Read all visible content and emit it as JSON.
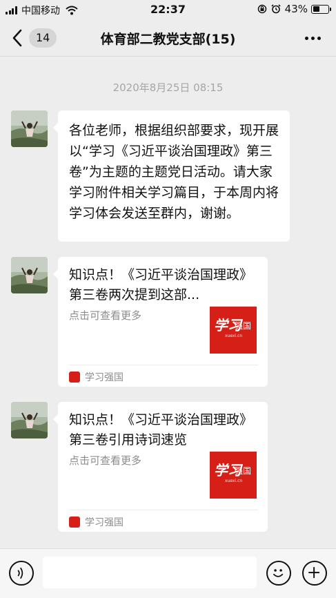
{
  "status_bar": {
    "carrier": "中国移动",
    "time": "22:37",
    "battery": "43%",
    "battery_level": 0.43
  },
  "nav": {
    "unread_count": "14",
    "title": "体育部二教党支部(15)"
  },
  "chat": {
    "timestamp": "2020年8月25日 08:15",
    "messages": [
      {
        "type": "text",
        "text": "各位老师，根据组织部要求，现开展以“学习《习近平谈治国理政》第三卷”为主题的主题党日活动。请大家学习附件相关学习篇目，于本周内将学习体会发送至群内，谢谢。"
      },
      {
        "type": "card",
        "title": "知识点！《习近平谈治国理政》第三卷两次提到这部...",
        "subtitle": "点击可查看更多",
        "source": "学习强国"
      },
      {
        "type": "card",
        "title": "知识点！《习近平谈治国理政》第三卷引用诗词速览",
        "subtitle": "点击可查看更多",
        "source": "学习强国"
      }
    ]
  },
  "thumb": {
    "logo_text": "学习",
    "brand": "强国",
    "domain": "xuexi.cn"
  },
  "colors": {
    "background": "#ededed",
    "bubble": "#ffffff",
    "brand_red": "#d61f17",
    "timestamp": "#a6a6a6"
  },
  "icons": [
    "signal-icon",
    "wifi-icon",
    "lock-rotation-icon",
    "alarm-icon",
    "battery-icon",
    "back-arrow-icon",
    "more-icon",
    "voice-icon",
    "emoji-icon",
    "plus-icon"
  ]
}
